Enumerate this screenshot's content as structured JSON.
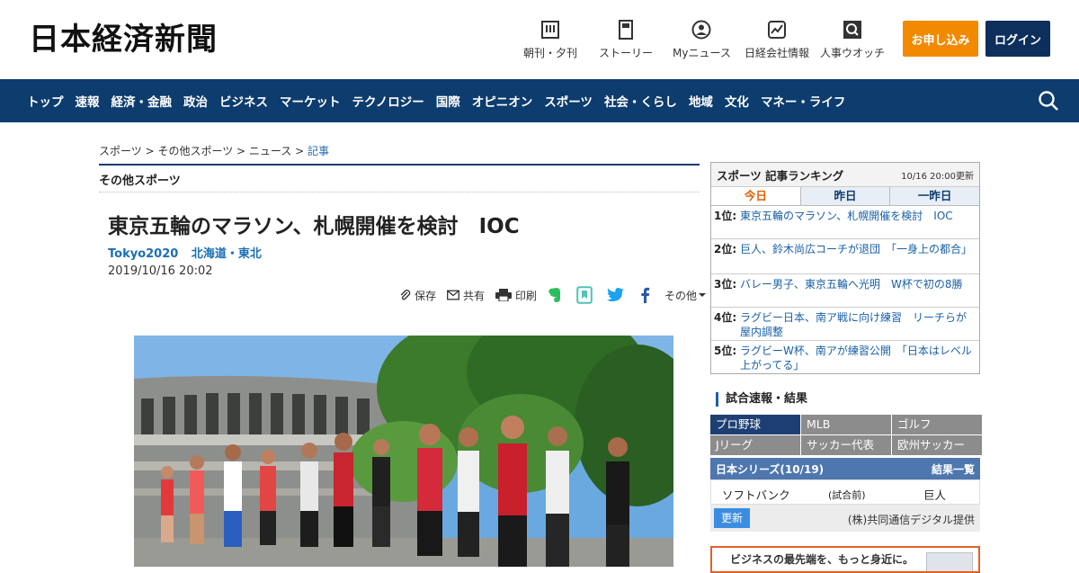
{
  "header": {
    "logo": "日本経済新聞",
    "icons": [
      {
        "label": "朝刊・夕刊",
        "icon": "newspaper-icon"
      },
      {
        "label": "ストーリー",
        "icon": "story-icon"
      },
      {
        "label": "Myニュース",
        "icon": "user-icon"
      },
      {
        "label": "日経会社情報",
        "icon": "chart-icon"
      },
      {
        "label": "人事ウオッチ",
        "icon": "search-person-icon"
      }
    ],
    "apply_label": "お申し込み",
    "login_label": "ログイン"
  },
  "nav": {
    "items": [
      "トップ",
      "速報",
      "経済・金融",
      "政治",
      "ビジネス",
      "マーケット",
      "テクノロジー",
      "国際",
      "オピニオン",
      "スポーツ",
      "社会・くらし",
      "地域",
      "文化",
      "マネー・ライフ"
    ]
  },
  "breadcrumb": {
    "items": [
      "スポーツ",
      "その他スポーツ",
      "ニュース"
    ],
    "current": "記事",
    "sep": " > "
  },
  "section": {
    "title": "その他スポーツ"
  },
  "article": {
    "headline": "東京五輪のマラソン、札幌開催を検討　IOC",
    "tags": [
      "Tokyo2020",
      "北海道・東北"
    ],
    "date": "2019/10/16 20:02",
    "share": {
      "save": "保存",
      "share": "共有",
      "print": "印刷",
      "more": "その他"
    }
  },
  "ranking": {
    "title": "スポーツ 記事ランキング",
    "updated": "10/16 20:00更新",
    "tabs": [
      "今日",
      "昨日",
      "一昨日"
    ],
    "items": [
      {
        "pos": "1位:",
        "title": "東京五輪のマラソン、札幌開催を検討　IOC"
      },
      {
        "pos": "2位:",
        "title": "巨人、鈴木尚広コーチが退団　「一身上の都合」"
      },
      {
        "pos": "3位:",
        "title": "バレー男子、東京五輪へ光明　W杯で初の8勝"
      },
      {
        "pos": "4位:",
        "title": "ラグビー日本、南ア戦に向け練習　リーチらが屋内調整"
      },
      {
        "pos": "5位:",
        "title": "ラグビーW杯、南アが練習公開　「日本はレベル上がってる」"
      }
    ]
  },
  "scores": {
    "heading": "試合速報・結果",
    "tabs": [
      "プロ野球",
      "MLB",
      "ゴルフ",
      "Jリーグ",
      "サッカー代表",
      "欧州サッカー"
    ],
    "series_title": "日本シリーズ(10/19)",
    "results_link": "結果一覧",
    "game": {
      "team1": "ソフトバンク",
      "status": "(試合前)",
      "team2": "巨人"
    },
    "refresh_label": "更新",
    "provider": "(株)共同通信デジタル提供"
  },
  "ad": {
    "text": "ビジネスの最先端を、もっと身近に。"
  }
}
